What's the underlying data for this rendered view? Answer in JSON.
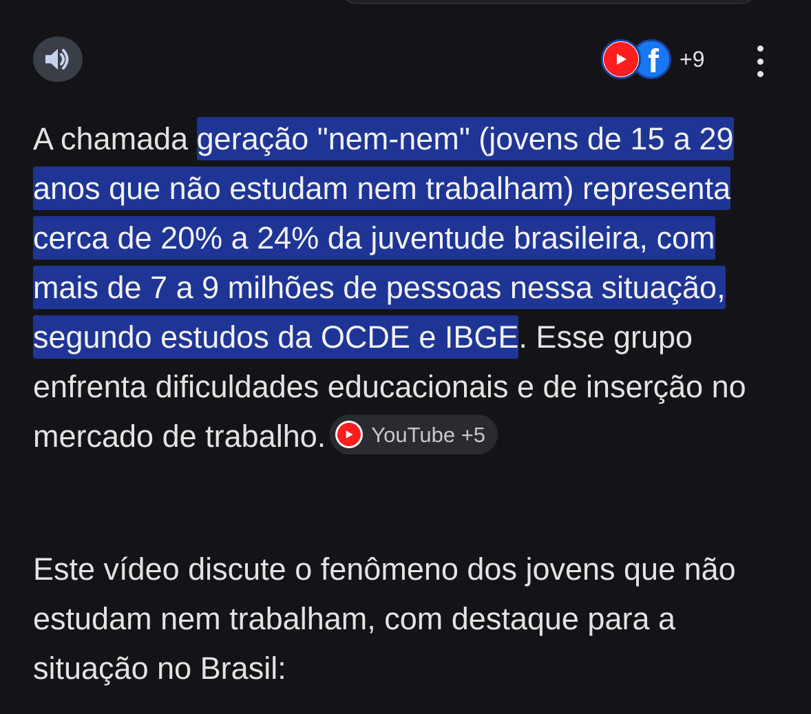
{
  "header": {
    "sources_count": "+9",
    "source_icons": [
      "youtube-icon",
      "facebook-icon"
    ],
    "facebook_letter": "f"
  },
  "answer": {
    "para1_plain_start": "A chamada ",
    "para1_highlight": "geração \"nem-nem\" (jovens de 15 a 29 anos que não estudam nem trabalham) representa cerca de 20% a 24% da juventude brasileira, com mais de 7 a 9 milhões de pessoas nessa situação, segundo estudos da OCDE e IBGE",
    "para1_plain_end": ". Esse grupo enfrenta dificuldades educacionais e de inserção no mercado de trabalho.",
    "source_chip": "YouTube +5",
    "para2": "Este vídeo discute o fenômeno dos jovens que não estudam nem trabalham, com destaque para a situação no Brasil:"
  },
  "colors": {
    "background": "#141418",
    "highlight": "#1f3595",
    "youtube_red": "#ff1d1d",
    "facebook_blue": "#1877f2"
  }
}
